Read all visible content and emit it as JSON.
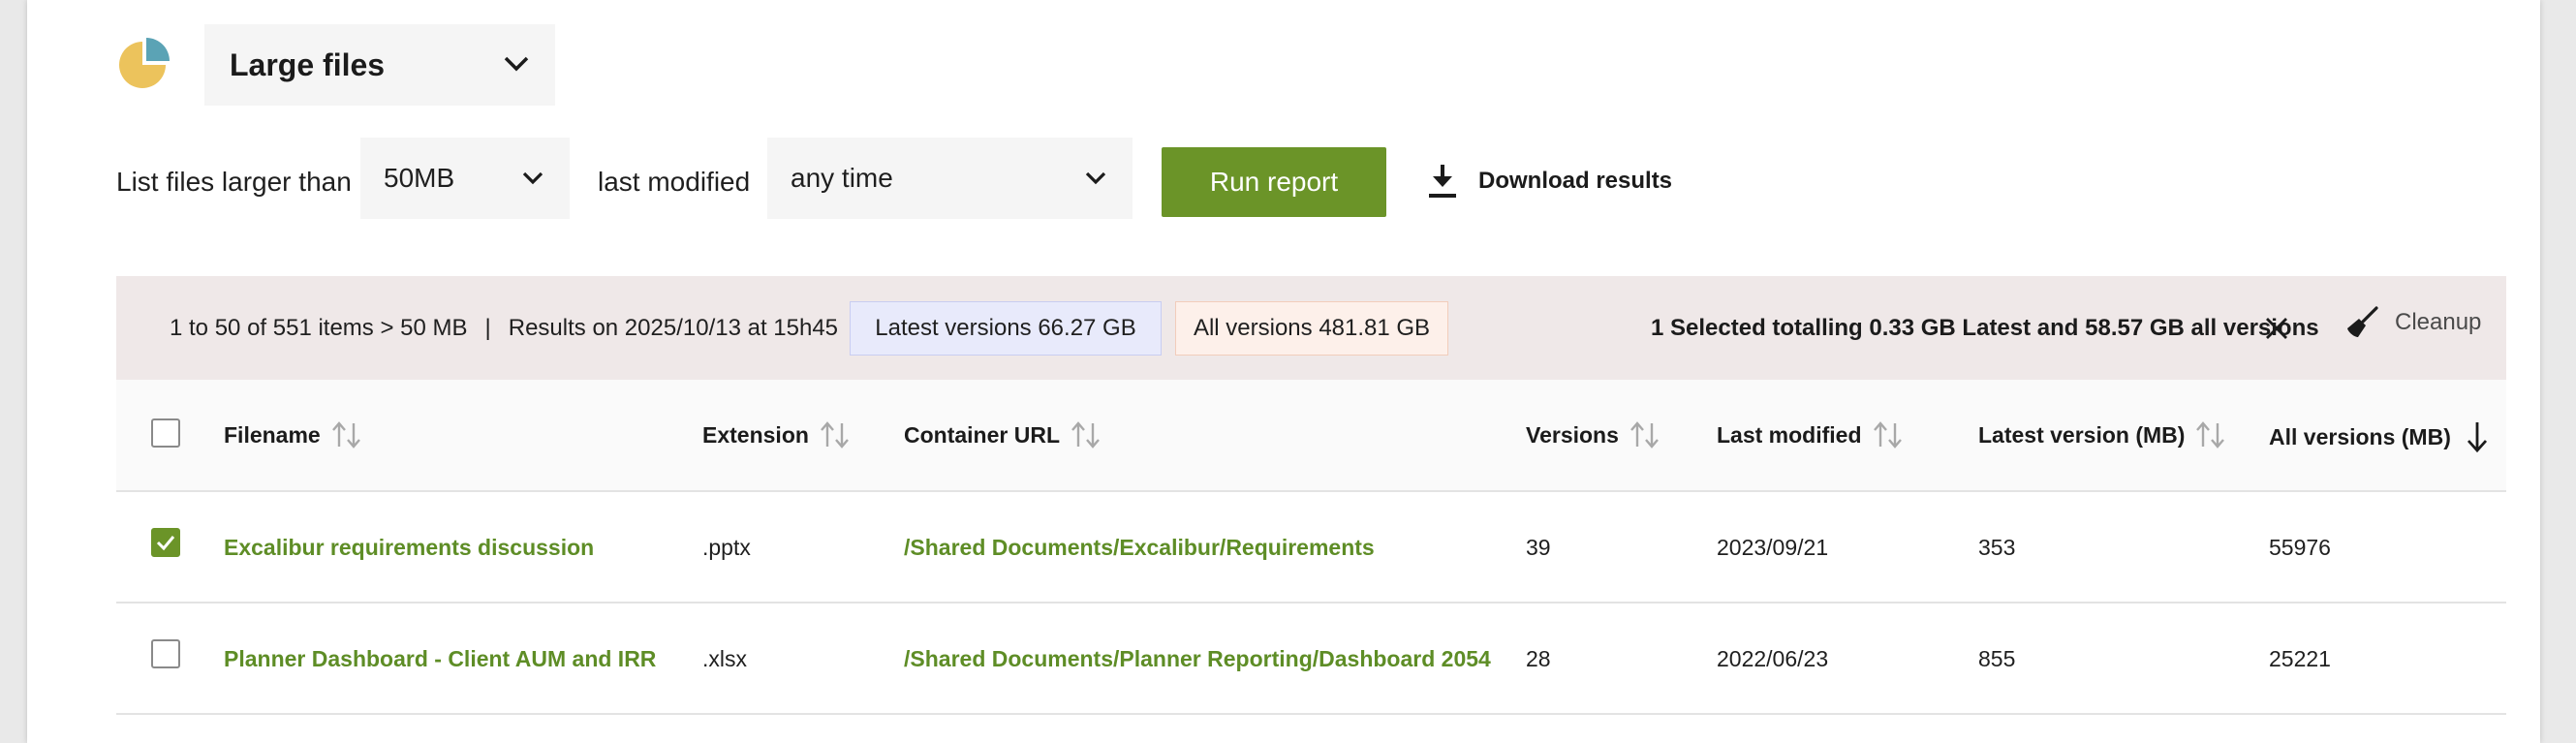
{
  "colors": {
    "accent_green": "#6b9428",
    "link_green": "#5e8d26",
    "status_bar_bg": "#efe8e8",
    "latest_badge_bg": "#e8eafb",
    "all_badge_bg": "#fdf0ea",
    "pie_yellow": "#ecc35c",
    "pie_teal": "#5ba3b5"
  },
  "header": {
    "icon": "pie-chart-icon",
    "report_type": "Large files"
  },
  "filters": {
    "size_label": "List files larger than",
    "size_value": "50MB",
    "modified_label": "last modified",
    "modified_value": "any time",
    "run_button": "Run report",
    "download_label": "Download results"
  },
  "status": {
    "range_text": "1 to 50 of 551 items > 50 MB",
    "separator": "|",
    "results_text": "Results on 2025/10/13 at 15h45",
    "latest_versions": "Latest versions 66.27 GB",
    "all_versions": "All versions 481.81 GB",
    "selected_text": "1 Selected totalling 0.33 GB Latest and 58.57 GB all versions",
    "cleanup_label": "Cleanup"
  },
  "table": {
    "columns": [
      {
        "key": "filename",
        "label": "Filename"
      },
      {
        "key": "extension",
        "label": "Extension"
      },
      {
        "key": "container_url",
        "label": "Container URL"
      },
      {
        "key": "versions",
        "label": "Versions"
      },
      {
        "key": "last_modified",
        "label": "Last modified"
      },
      {
        "key": "latest_version_mb",
        "label": "Latest version (MB)"
      },
      {
        "key": "all_versions_mb",
        "label": "All versions (MB)"
      }
    ],
    "sorted_column": "all_versions_mb",
    "sort_direction": "descending",
    "rows": [
      {
        "selected": true,
        "filename": "Excalibur requirements discussion",
        "extension": ".pptx",
        "container_url": "/Shared Documents/Excalibur/Requirements",
        "versions": "39",
        "last_modified": "2023/09/21",
        "latest_version_mb": "353",
        "all_versions_mb": "55976"
      },
      {
        "selected": false,
        "filename": "Planner Dashboard - Client AUM and IRR",
        "extension": ".xlsx",
        "container_url": "/Shared Documents/Planner Reporting/Dashboard 2054",
        "versions": "28",
        "last_modified": "2022/06/23",
        "latest_version_mb": "855",
        "all_versions_mb": "25221"
      }
    ]
  }
}
